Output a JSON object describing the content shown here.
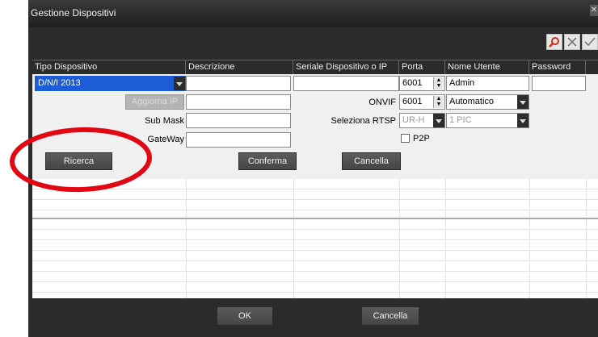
{
  "window": {
    "title": "Gestione Dispositivi"
  },
  "toolbar": {
    "icons": [
      "search-icon",
      "close-icon",
      "checkmark-icon"
    ]
  },
  "table": {
    "headers": [
      "Tipo Dispositivo",
      "Descrizione",
      "Seriale Dispositivo o IP",
      "Porta",
      "Nome Utente",
      "Password"
    ]
  },
  "form": {
    "device_type": "D/N/I 2013",
    "description": "",
    "serial_ip": "",
    "port": "6001",
    "username": "Admin",
    "password": "",
    "update_ip_label": "Aggiorna IP",
    "submask_label": "Sub Mask",
    "gateway_label": "GateWay",
    "onvif_label": "ONVIF",
    "onvif_port": "6001",
    "onvif_mode": "Automatico",
    "rtsp_label": "Seleziona RTSP",
    "rtsp_value": "UR-H",
    "rtsp_pic": "1 PIC",
    "p2p_label": "P2P",
    "p2p_checked": false
  },
  "buttons": {
    "search": "Ricerca",
    "confirm": "Conferma",
    "cancel": "Cancella",
    "ok": "OK",
    "cancel_bottom": "Cancella"
  },
  "colors": {
    "window_bg": "#2b2b2b",
    "highlight_red": "#e30613",
    "selected_blue": "#1c5cd6"
  }
}
